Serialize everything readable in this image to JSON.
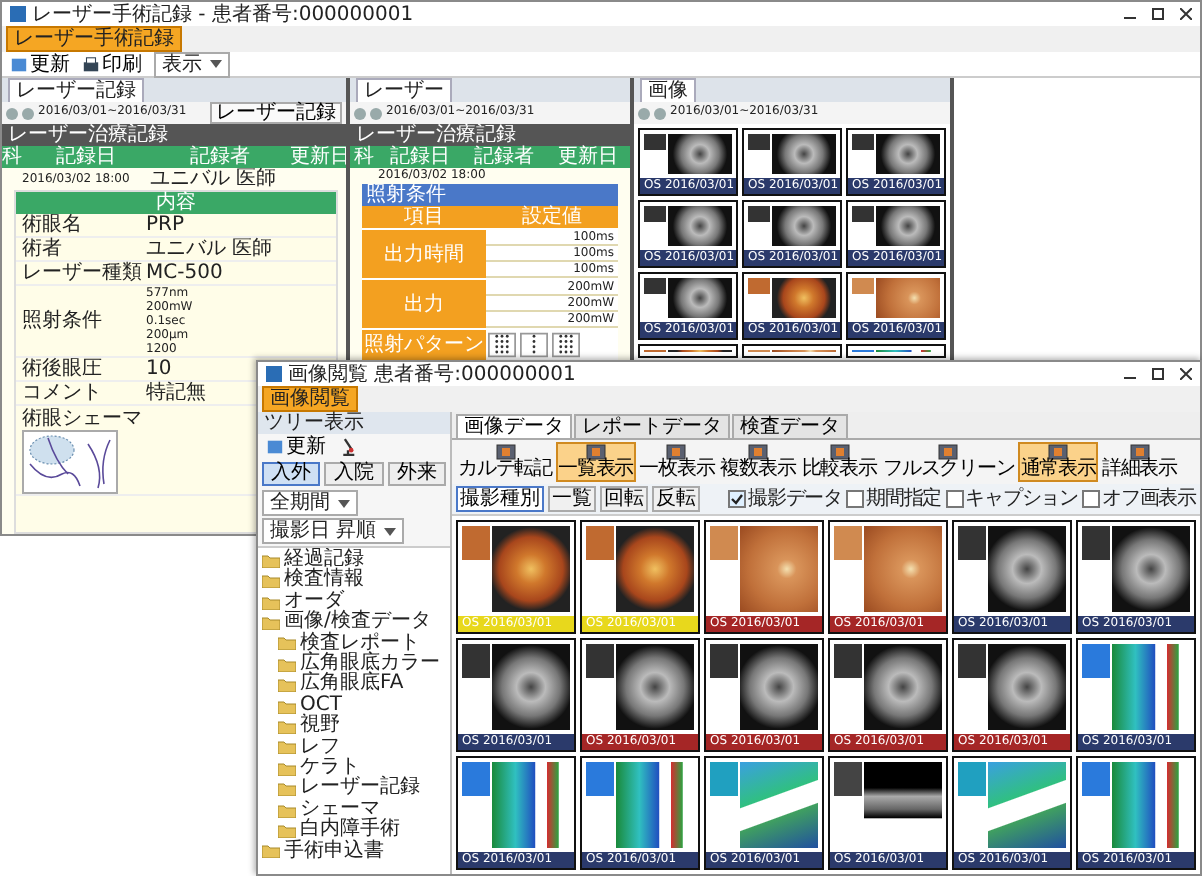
{
  "back_window": {
    "title": "レーザー手術記録 - 患者番号:000000001",
    "app_button": "レーザー手術記録",
    "toolbar": [
      {
        "label": "更新"
      },
      {
        "label": "印刷"
      }
    ],
    "view_select": "表示",
    "record_pane": {
      "tab": "レーザー記録",
      "date_range": "2016/03/01~2016/03/31",
      "filter_button": "レーザー記録",
      "section_title": "レーザー治療記録",
      "columns": [
        "科",
        "記録日",
        "記録者",
        "更新日"
      ],
      "row": {
        "date": "2016/03/02 18:00",
        "author": "ユニバル 医師"
      },
      "content_title": "内容",
      "fields": [
        {
          "label": "術眼名",
          "value": "PRP"
        },
        {
          "label": "術者",
          "value": "ユニバル 医師"
        },
        {
          "label": "レーザー種類",
          "value": "MC-500"
        }
      ],
      "conditions_label": "照射条件",
      "conditions": [
        "577nm",
        "200mW",
        "0.1sec",
        "200µm",
        "1200"
      ],
      "after_fields": [
        {
          "label": "術後眼圧",
          "value": "10"
        },
        {
          "label": "コメント",
          "value": "特記無"
        }
      ],
      "schema_label": "術眼シェーマ"
    },
    "laser_pane": {
      "tab": "レーザー",
      "date_range": "2016/03/01~2016/03/31",
      "section_title": "レーザー治療記録",
      "columns": [
        "科",
        "記録日",
        "記録者",
        "更新日"
      ],
      "row_date": "2016/03/02 18:00",
      "form_title": "照射条件",
      "table_header": [
        "項目",
        "設定値"
      ],
      "params": [
        {
          "label": "出力時間",
          "values": [
            "100ms",
            "100ms",
            "100ms"
          ]
        },
        {
          "label": "出力",
          "values": [
            "200mW",
            "200mW",
            "200mW"
          ]
        }
      ],
      "pattern_label": "照射パターン"
    },
    "image_pane": {
      "tab": "画像",
      "date_range": "2016/03/01~2016/03/31",
      "thumbnails": [
        {
          "kind": "fa",
          "caption": "OS 2016/03/01",
          "color": "#2b3a6b"
        },
        {
          "kind": "fa",
          "caption": "OS 2016/03/01",
          "color": "#2b3a6b"
        },
        {
          "kind": "fa",
          "caption": "OS 2016/03/01",
          "color": "#2b3a6b"
        },
        {
          "kind": "fa",
          "caption": "OS 2016/03/01",
          "color": "#2b3a6b"
        },
        {
          "kind": "fa",
          "caption": "OS 2016/03/01",
          "color": "#2b3a6b"
        },
        {
          "kind": "fa",
          "caption": "OS 2016/03/01",
          "color": "#2b3a6b"
        },
        {
          "kind": "fa",
          "caption": "OS 2016/03/01",
          "color": "#2b3a6b"
        },
        {
          "kind": "fundus",
          "caption": "OS 2016/03/01",
          "color": "#2b3a6b"
        },
        {
          "kind": "fundus_wide",
          "caption": "OS 2016/03/01",
          "color": "#2b3a6b"
        },
        {
          "kind": "fundus"
        },
        {
          "kind": "fundus_wide"
        },
        {
          "kind": "octmap"
        }
      ]
    }
  },
  "front_window": {
    "title": "画像閲覧 患者番号:000000001",
    "app_button": "画像閲覧",
    "tree_panel": {
      "title": "ツリー表示",
      "refresh": "更新",
      "tabs": [
        {
          "label": "入外",
          "selected": true
        },
        {
          "label": "入院",
          "selected": false
        },
        {
          "label": "外来",
          "selected": false
        }
      ],
      "period": "全期間",
      "sort": "撮影日 昇順",
      "items": [
        {
          "label": "経過記録"
        },
        {
          "label": "検査情報"
        },
        {
          "label": "オーダ"
        },
        {
          "label": "画像/検査データ",
          "children": [
            {
              "label": "検査レポート"
            },
            {
              "label": "広角眼底カラー"
            },
            {
              "label": "広角眼底FA"
            },
            {
              "label": "OCT"
            },
            {
              "label": "視野"
            },
            {
              "label": "レフ"
            },
            {
              "label": "ケラト"
            },
            {
              "label": "レーザー記録"
            },
            {
              "label": "シェーマ"
            },
            {
              "label": "白内障手術"
            }
          ]
        },
        {
          "label": "手術申込書"
        }
      ]
    },
    "tabs": [
      {
        "label": "画像データ",
        "selected": true
      },
      {
        "label": "レポートデータ",
        "selected": false
      },
      {
        "label": "検査データ",
        "selected": false
      }
    ],
    "toolbar": [
      {
        "label": "カルテ転記",
        "selected": false
      },
      {
        "label": "一覧表示",
        "selected": true
      },
      {
        "label": "一枚表示",
        "selected": false
      },
      {
        "label": "複数表示",
        "selected": false
      },
      {
        "label": "比較表示",
        "selected": false
      },
      {
        "label": "フルスクリーン",
        "selected": false
      },
      {
        "label": "通常表示",
        "selected": true
      },
      {
        "label": "詳細表示",
        "selected": false
      }
    ],
    "options": [
      {
        "label": "撮影データ",
        "checked": true
      },
      {
        "label": "期間指定",
        "checked": false
      },
      {
        "label": "キャプション",
        "checked": false
      },
      {
        "label": "オフ画表示",
        "checked": false
      }
    ],
    "subtabs": [
      {
        "label": "撮影種別",
        "selected": true
      },
      {
        "label": "一覧",
        "selected": false
      },
      {
        "label": "回転",
        "selected": false
      },
      {
        "label": "反転",
        "selected": false
      }
    ],
    "thumbnails": [
      {
        "kind": "fundus",
        "caption": "OS 2016/03/01",
        "color": "#e8d81c"
      },
      {
        "kind": "fundus",
        "caption": "OS 2016/03/01",
        "color": "#e8d81c"
      },
      {
        "kind": "fundus_wide",
        "caption": "OS 2016/03/01",
        "color": "#a52626"
      },
      {
        "kind": "fundus_wide",
        "caption": "OS 2016/03/01",
        "color": "#a52626"
      },
      {
        "kind": "fa",
        "caption": "OS 2016/03/01",
        "color": "#2b3a6b"
      },
      {
        "kind": "fa",
        "caption": "OS 2016/03/01",
        "color": "#2b3a6b"
      },
      {
        "kind": "fa",
        "caption": "OS 2016/03/01",
        "color": "#2b3a6b"
      },
      {
        "kind": "fa",
        "caption": "OS 2016/03/01",
        "color": "#a52626"
      },
      {
        "kind": "fa",
        "caption": "OS 2016/03/01",
        "color": "#a52626"
      },
      {
        "kind": "fa",
        "caption": "OS 2016/03/01",
        "color": "#a52626"
      },
      {
        "kind": "fa",
        "caption": "OS 2016/03/01",
        "color": "#a52626"
      },
      {
        "kind": "octmap",
        "caption": "OS 2016/03/01",
        "color": "#2b3a6b"
      },
      {
        "kind": "octmap",
        "caption": "OS 2016/03/01",
        "color": "#2b3a6b"
      },
      {
        "kind": "octmap",
        "caption": "OS 2016/03/01",
        "color": "#2b3a6b"
      },
      {
        "kind": "oct3d",
        "caption": "OS 2016/03/01",
        "color": "#2b3a6b"
      },
      {
        "kind": "octscan",
        "caption": "OS 2016/03/01",
        "color": "#2b3a6b"
      },
      {
        "kind": "oct3d",
        "caption": "OS 2016/03/01",
        "color": "#2b3a6b"
      },
      {
        "kind": "octmap",
        "caption": "OS 2016/03/01",
        "color": "#2b3a6b"
      }
    ]
  }
}
